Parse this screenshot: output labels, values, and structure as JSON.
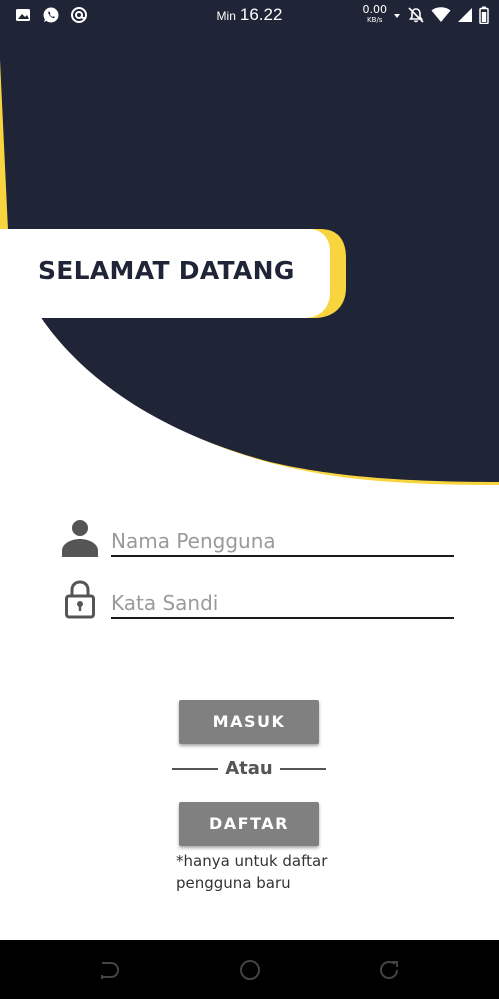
{
  "status_bar": {
    "time_period": "Min",
    "time": "16.22",
    "net_speed_value": "0.00",
    "net_speed_unit": "KB/s",
    "left_icons": [
      "image-icon",
      "whatsapp-icon",
      "at-sign-icon"
    ],
    "right_icons": [
      "data-arrows-icon",
      "alarm-off-icon",
      "wifi-icon",
      "signal-icon",
      "battery-icon"
    ]
  },
  "header": {
    "welcome_title": "SELAMAT DATANG",
    "colors": {
      "dark": "#1f2536",
      "accent": "#f8d53e"
    }
  },
  "form": {
    "username": {
      "placeholder": "Nama Pengguna",
      "value": ""
    },
    "password": {
      "placeholder": "Kata Sandi",
      "value": ""
    }
  },
  "actions": {
    "login_label": "MASUK",
    "or_label": "Atau",
    "register_label": "DAFTAR",
    "register_note": "*hanya untuk daftar pengguna baru"
  },
  "nav_bar": {
    "buttons": [
      "back-icon",
      "home-icon",
      "recents-icon"
    ]
  }
}
